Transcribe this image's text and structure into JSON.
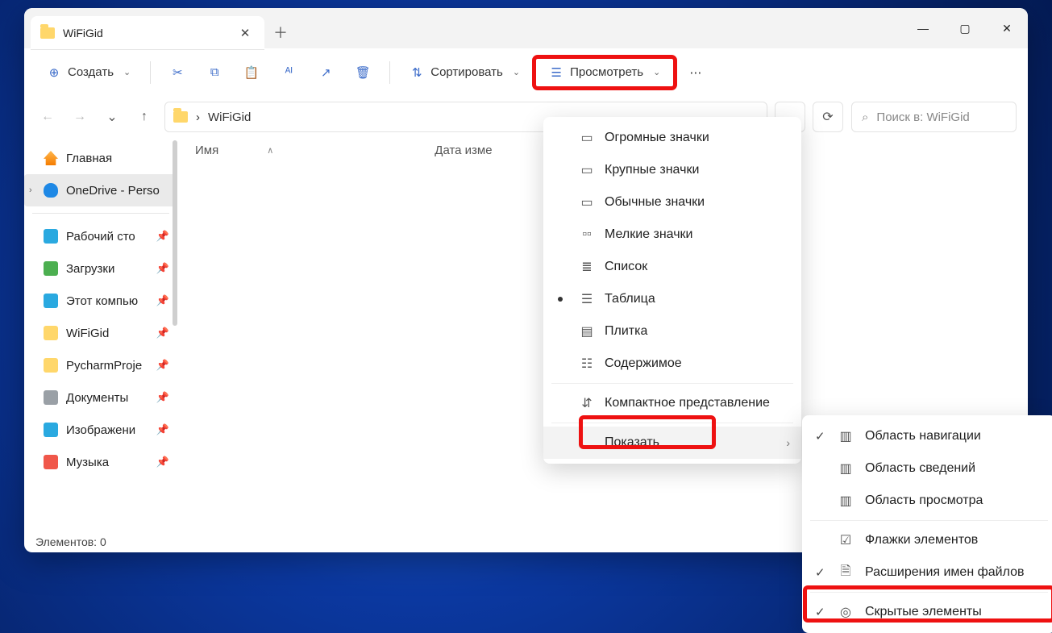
{
  "tab": {
    "title": "WiFiGid"
  },
  "toolbar": {
    "new_label": "Создать",
    "sort_label": "Сортировать",
    "view_label": "Просмотреть"
  },
  "address": {
    "path": "WiFiGid",
    "separator": "›"
  },
  "search": {
    "placeholder": "Поиск в: WiFiGid"
  },
  "columns": {
    "name": "Имя",
    "date": "Дата изме"
  },
  "sidebar": {
    "home": "Главная",
    "onedrive": "OneDrive - Perso",
    "items": [
      {
        "label": "Рабочий сто",
        "icon": "desktop",
        "color": "#2aa9e0"
      },
      {
        "label": "Загрузки",
        "icon": "download",
        "color": "#4caf50"
      },
      {
        "label": "Этот компью",
        "icon": "pc",
        "color": "#2aa9e0"
      },
      {
        "label": "WiFiGid",
        "icon": "folder",
        "color": "#ffd76b"
      },
      {
        "label": "PycharmProje",
        "icon": "folder",
        "color": "#ffd76b"
      },
      {
        "label": "Документы",
        "icon": "doc",
        "color": "#9aa0a6"
      },
      {
        "label": "Изображени",
        "icon": "image",
        "color": "#2aa9e0"
      },
      {
        "label": "Музыка",
        "icon": "music",
        "color": "#f0574a"
      }
    ]
  },
  "menu_view": {
    "items": [
      {
        "label": "Огромные значки"
      },
      {
        "label": "Крупные значки"
      },
      {
        "label": "Обычные значки"
      },
      {
        "label": "Мелкие значки"
      },
      {
        "label": "Список"
      },
      {
        "label": "Таблица",
        "selected": true
      },
      {
        "label": "Плитка"
      },
      {
        "label": "Содержимое"
      }
    ],
    "compact": "Компактное представление",
    "show": "Показать"
  },
  "menu_show": {
    "items": [
      {
        "label": "Область навигации",
        "checked": true
      },
      {
        "label": "Область сведений",
        "checked": false
      },
      {
        "label": "Область просмотра",
        "checked": false
      },
      {
        "label": "Флажки элементов",
        "checked": false
      },
      {
        "label": "Расширения имен файлов",
        "checked": true
      },
      {
        "label": "Скрытые элементы",
        "checked": true
      }
    ]
  },
  "status": {
    "text": "Элементов: 0"
  }
}
